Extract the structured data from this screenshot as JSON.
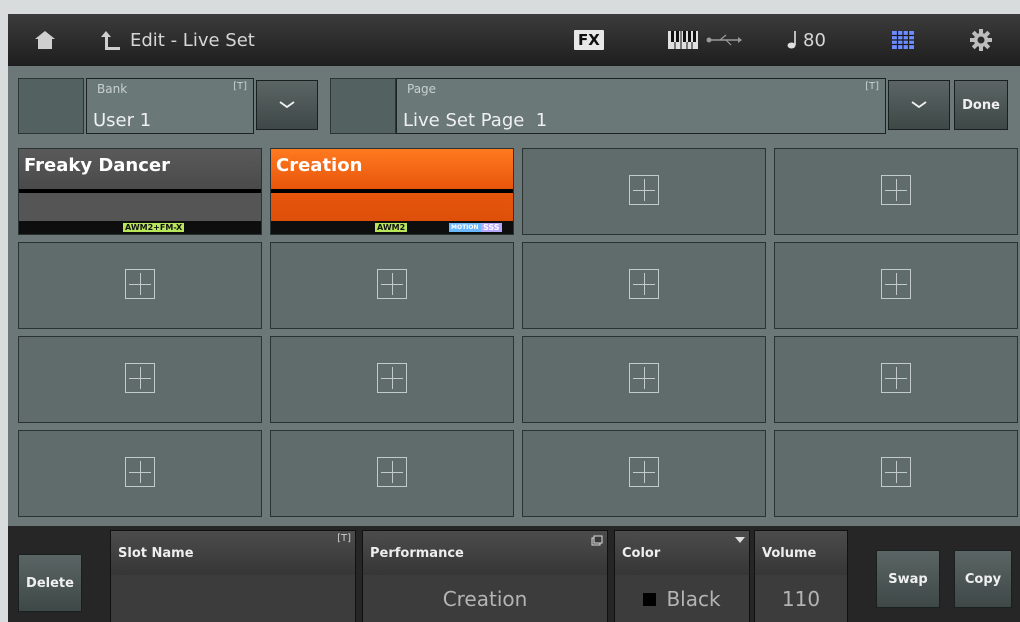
{
  "topbar": {
    "title": "Edit - Live Set",
    "fx_label": "FX",
    "tempo_value": "80"
  },
  "header": {
    "bank": {
      "label": "Bank",
      "value": "User 1",
      "text_icon": "[T]"
    },
    "page": {
      "label": "Page",
      "value": "Live Set Page  1",
      "text_icon": "[T]"
    },
    "done_label": "Done"
  },
  "slots": [
    {
      "name": "Freaky Dancer",
      "color": "#4a4a4a",
      "tags": [
        "AWM2+FM-X"
      ]
    },
    {
      "name": "Creation",
      "color": "#e8550c",
      "tags": [
        "AWM2",
        "MOTION",
        "SSS"
      ]
    }
  ],
  "empty_slot_count": 14,
  "bottom": {
    "delete_label": "Delete",
    "slot_name": {
      "label": "Slot Name",
      "value": "",
      "text_icon": "[T]"
    },
    "performance": {
      "label": "Performance",
      "value": "Creation"
    },
    "color": {
      "label": "Color",
      "value": "Black",
      "swatch": "#000000"
    },
    "volume": {
      "label": "Volume",
      "value": "110"
    },
    "swap_label": "Swap",
    "copy_label": "Copy"
  },
  "icons": [
    "home-icon",
    "back-arrow-icon",
    "fx-icon",
    "keyboard-icon",
    "usb-icon",
    "quarter-note-icon",
    "grid-view-icon",
    "gear-icon",
    "chevron-down-icon",
    "plus-icon"
  ]
}
